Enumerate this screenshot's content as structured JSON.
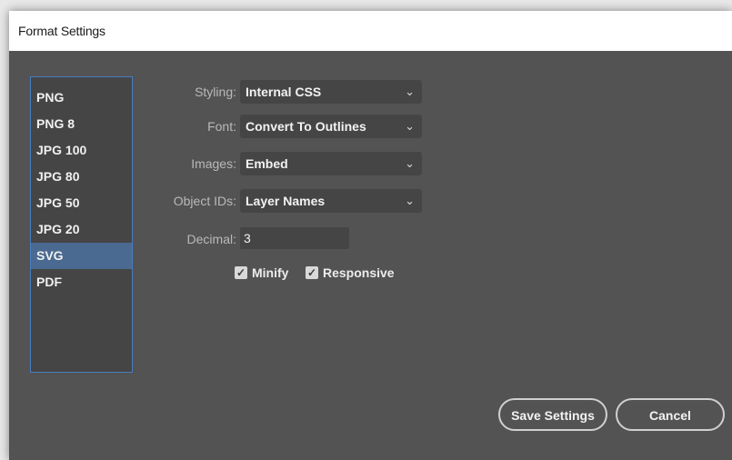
{
  "window": {
    "title": "Format Settings"
  },
  "formats": [
    "PNG",
    "PNG 8",
    "JPG 100",
    "JPG 80",
    "JPG 50",
    "JPG 20",
    "SVG",
    "PDF"
  ],
  "selected_format": "SVG",
  "settings": {
    "styling": {
      "label": "Styling:",
      "value": "Internal CSS"
    },
    "font": {
      "label": "Font:",
      "value": "Convert To Outlines"
    },
    "images": {
      "label": "Images:",
      "value": "Embed"
    },
    "object_ids": {
      "label": "Object IDs:",
      "value": "Layer Names"
    },
    "decimal": {
      "label": "Decimal:",
      "value": "3"
    },
    "minify": {
      "label": "Minify",
      "checked": true
    },
    "responsive": {
      "label": "Responsive",
      "checked": true
    }
  },
  "buttons": {
    "save": "Save Settings",
    "cancel": "Cancel"
  },
  "icons": {
    "dropdown": "chevron-down-icon",
    "checkbox": "checkmark-icon"
  }
}
